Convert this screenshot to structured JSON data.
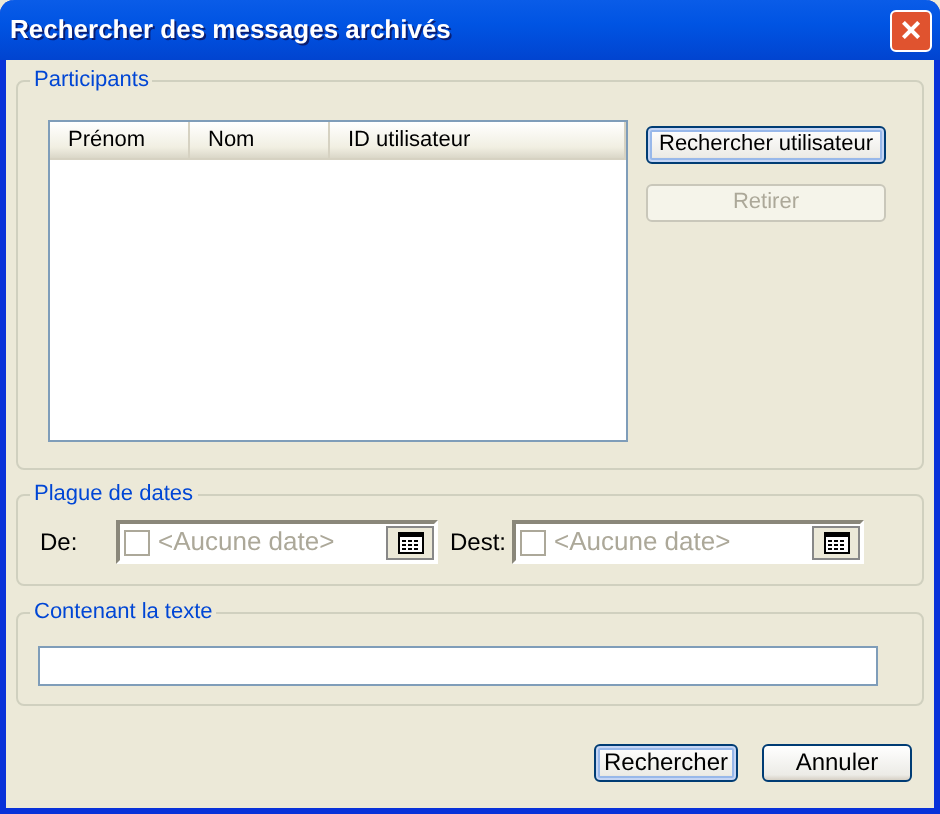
{
  "window": {
    "title": "Rechercher des messages archivés",
    "close": "×"
  },
  "participants": {
    "legend": "Participants",
    "columns": [
      "Prénom",
      "Nom",
      "ID utilisateur"
    ],
    "buttons": [
      {
        "label": "Rechercher utilisateur",
        "disabled": false,
        "focused": true
      },
      {
        "label": "Retirer",
        "disabled": true,
        "focused": false
      }
    ]
  },
  "date_range": {
    "legend": "Plague de dates",
    "fields": [
      {
        "label": "De:",
        "checked": false,
        "placeholder": "<Aucune date>"
      },
      {
        "label": "Dest:",
        "checked": false,
        "placeholder": "<Aucune date>"
      }
    ]
  },
  "text_filter": {
    "legend": "Contenant la texte"
  },
  "buttons": [
    {
      "label": "Rechercher",
      "default": true
    },
    {
      "label": "Annuler",
      "default": false
    }
  ]
}
